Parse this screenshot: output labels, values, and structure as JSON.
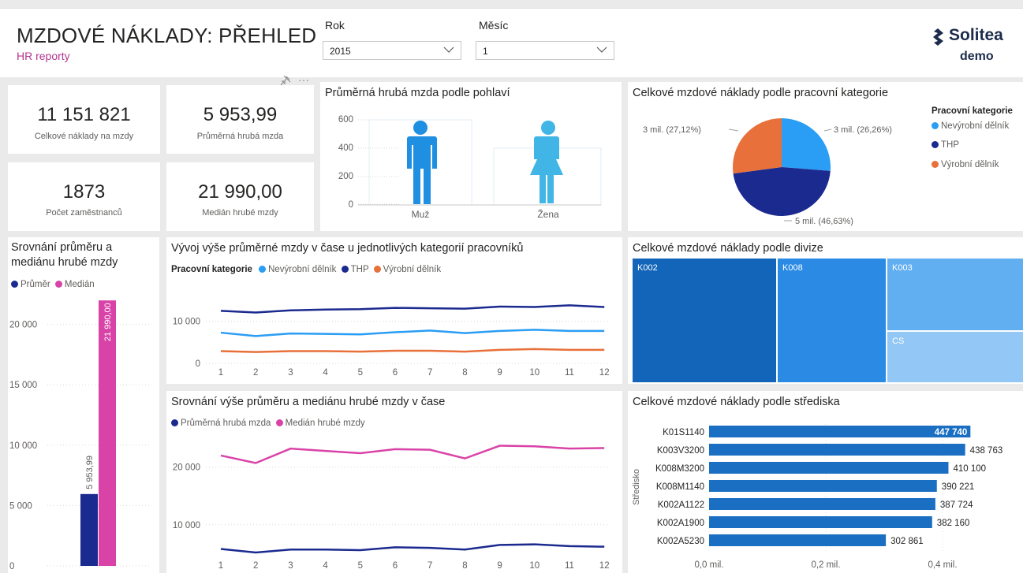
{
  "header": {
    "title": "MZDOVÉ NÁKLADY: PŘEHLED",
    "subtitle": "HR reporty",
    "logo_name": "Solitea",
    "logo_sub": "demo"
  },
  "slicers": {
    "year_label": "Rok",
    "year_value": "2015",
    "month_label": "Měsíc",
    "month_value": "1"
  },
  "kpis": [
    {
      "value": "11 151 821",
      "label": "Celkové náklady na mzdy"
    },
    {
      "value": "5 953,99",
      "label": "Průměrná hrubá mzda"
    },
    {
      "value": "1873",
      "label": "Počet zaměstnanců"
    },
    {
      "value": "21 990,00",
      "label": "Medián hrubé mzdy"
    }
  ],
  "gender_chart": {
    "title": "Průměrná hrubá mzda podle pohlaví",
    "y_ticks": [
      "600",
      "400",
      "200",
      "0"
    ],
    "categories": [
      "Muž",
      "Žena"
    ]
  },
  "pie_chart": {
    "title": "Celkové mzdové náklady podle pracovní kategorie",
    "legend_title": "Pracovní kategorie",
    "legend": [
      "Nevýrobní dělník",
      "THP",
      "Výrobní dělník"
    ],
    "labels": [
      "3 mil. (26,26%)",
      "5 mil. (46,63%)",
      "3 mil. (27,12%)"
    ]
  },
  "mean_median": {
    "title_line1": "Srovnání průměru a",
    "title_line2": "mediánu hrubé mzdy",
    "legend": [
      "Průměr",
      "Medián"
    ],
    "y_ticks": [
      "20 000",
      "15 000",
      "10 000",
      "5 000",
      "0"
    ],
    "bar_labels": [
      "5 953,99",
      "21 990,00"
    ]
  },
  "category_trend": {
    "title": "Vývoj výše průměrné mzdy v čase u jednotlivých kategorií pracovníků",
    "legend_title": "Pracovní kategorie",
    "legend": [
      "Nevýrobní dělník",
      "THP",
      "Výrobní dělník"
    ],
    "y_ticks": [
      "10 000",
      "0"
    ],
    "x_ticks": [
      "1",
      "2",
      "3",
      "4",
      "5",
      "6",
      "7",
      "8",
      "9",
      "10",
      "11",
      "12"
    ]
  },
  "division": {
    "title": "Celkové mzdové náklady podle divize",
    "cells": [
      "K002",
      "K008",
      "K003",
      "CS"
    ]
  },
  "mean_median_trend": {
    "title": "Srovnání výše průměru a mediánu hrubé mzdy v čase",
    "legend": [
      "Průměrná hrubá mzda",
      "Medián hrubé mzdy"
    ],
    "y_ticks": [
      "20 000",
      "10 000"
    ],
    "x_ticks": [
      "1",
      "2",
      "3",
      "4",
      "5",
      "6",
      "7",
      "8",
      "9",
      "10",
      "11",
      "12"
    ]
  },
  "center_chart": {
    "title": "Celkové mzdové náklady podle střediska",
    "axis_label": "Středisko",
    "x_ticks": [
      "0,0 mil.",
      "0,2 mil.",
      "0,4 mil."
    ],
    "bars": [
      {
        "name": "K01S1140",
        "label": "447 740"
      },
      {
        "name": "K003V3200",
        "label": "438 763"
      },
      {
        "name": "K008M3200",
        "label": "410 100"
      },
      {
        "name": "K008M1140",
        "label": "390 221"
      },
      {
        "name": "K002A1122",
        "label": "387 724"
      },
      {
        "name": "K002A1900",
        "label": "382 160"
      },
      {
        "name": "K002A5230",
        "label": "302 861"
      }
    ]
  },
  "colors": {
    "navy": "#1b2a8f",
    "light_blue": "#2a9df4",
    "orange": "#e8703a",
    "pink": "#d943a8",
    "magenta_subtitle": "#b3358f",
    "bar_blue": "#1a6fc2"
  },
  "chart_data": [
    {
      "type": "bar",
      "title": "Srovnání průměru a mediánu hrubé mzdy",
      "categories": [
        "Průměr",
        "Medián"
      ],
      "values": [
        5953.99,
        21990.0
      ],
      "ylim": [
        0,
        22000
      ]
    },
    {
      "type": "line",
      "title": "Vývoj výše průměrné mzdy v čase u jednotlivých kategorií pracovníků",
      "x": [
        1,
        2,
        3,
        4,
        5,
        6,
        7,
        8,
        9,
        10,
        11,
        12
      ],
      "series": [
        {
          "name": "Nevýrobní dělník",
          "values": [
            7300,
            6500,
            7100,
            7000,
            6900,
            7400,
            7800,
            7200,
            7700,
            8000,
            7700,
            7700
          ]
        },
        {
          "name": "THP",
          "values": [
            12500,
            12100,
            12600,
            12800,
            12900,
            13200,
            13100,
            13000,
            13500,
            13400,
            13800,
            13400
          ]
        },
        {
          "name": "Výrobní dělník",
          "values": [
            2900,
            2700,
            2900,
            2900,
            2800,
            3000,
            3000,
            2800,
            3200,
            3400,
            3200,
            3200
          ]
        }
      ],
      "ylim": [
        0,
        15000
      ]
    },
    {
      "type": "line",
      "title": "Srovnání výše průměru a mediánu hrubé mzdy v čase",
      "x": [
        1,
        2,
        3,
        4,
        5,
        6,
        7,
        8,
        9,
        10,
        11,
        12
      ],
      "series": [
        {
          "name": "Průměrná hrubá mzda",
          "values": [
            5800,
            5200,
            5700,
            5700,
            5600,
            6100,
            6000,
            5700,
            6500,
            6600,
            6300,
            6200
          ]
        },
        {
          "name": "Medián hrubé mzdy",
          "values": [
            22000,
            20700,
            23200,
            22800,
            22400,
            23100,
            23000,
            21500,
            23700,
            23600,
            23200,
            23300
          ]
        }
      ],
      "ylim": [
        0,
        25000
      ]
    },
    {
      "type": "pie",
      "title": "Celkové mzdové náklady podle pracovní kategorie",
      "categories": [
        "Nevýrobní dělník",
        "THP",
        "Výrobní dělník"
      ],
      "values": [
        26.26,
        46.63,
        27.12
      ]
    },
    {
      "type": "bar",
      "title": "Celkové mzdové náklady podle střediska",
      "categories": [
        "K01S1140",
        "K003V3200",
        "K008M3200",
        "K008M1140",
        "K002A1122",
        "K002A1900",
        "K002A5230"
      ],
      "values": [
        447740,
        438763,
        410100,
        390221,
        387724,
        382160,
        302861
      ]
    }
  ]
}
